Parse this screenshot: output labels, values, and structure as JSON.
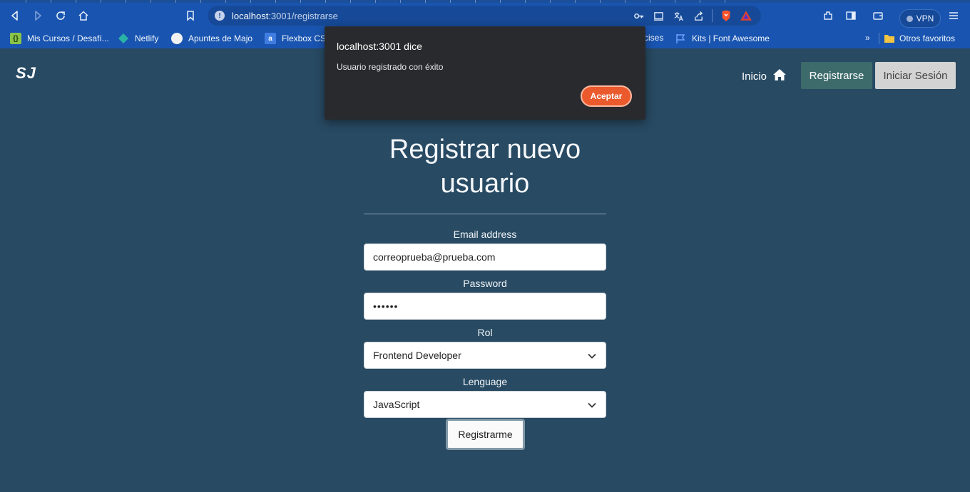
{
  "browser": {
    "url_host": "localhost",
    "url_path": ":3001/registrarse",
    "vpn_label": "VPN",
    "bookmarks": [
      {
        "label": "Mis Cursos / Desafí...",
        "icon": "code-icon"
      },
      {
        "label": "Netlify",
        "icon": "netlify-icon"
      },
      {
        "label": "Apuntes de Majo",
        "icon": "circle-icon"
      },
      {
        "label": "Flexbox CSS",
        "icon": "a-icon"
      },
      {
        "label": "cises",
        "icon": ""
      },
      {
        "label": "Kits | Font Awesome",
        "icon": "flag-icon"
      },
      {
        "label": "»",
        "icon": ""
      },
      {
        "label": "Otros favoritos",
        "icon": "folder-icon"
      }
    ]
  },
  "navbar": {
    "logo": "SJ",
    "inicio": "Inicio",
    "registrarse": "Registrarse",
    "iniciar_sesion": "Iniciar Sesión"
  },
  "form": {
    "title_line1": "Registrar nuevo",
    "title_line2": "usuario",
    "email_label": "Email address",
    "email_value": "correoprueba@prueba.com",
    "password_label": "Password",
    "password_value": "••••••",
    "rol_label": "Rol",
    "rol_value": "Frontend Developer",
    "lenguage_label": "Lenguage",
    "lenguage_value": "JavaScript",
    "submit": "Registrarme"
  },
  "dialog": {
    "title": "localhost:3001 dice",
    "message": "Usuario registrado con éxito",
    "ok": "Aceptar"
  },
  "colors": {
    "page_bg": "#284a63",
    "browser_bar": "#1955b0",
    "accent_button": "#3d6b6b",
    "dialog_ok": "#ea5a2d"
  }
}
